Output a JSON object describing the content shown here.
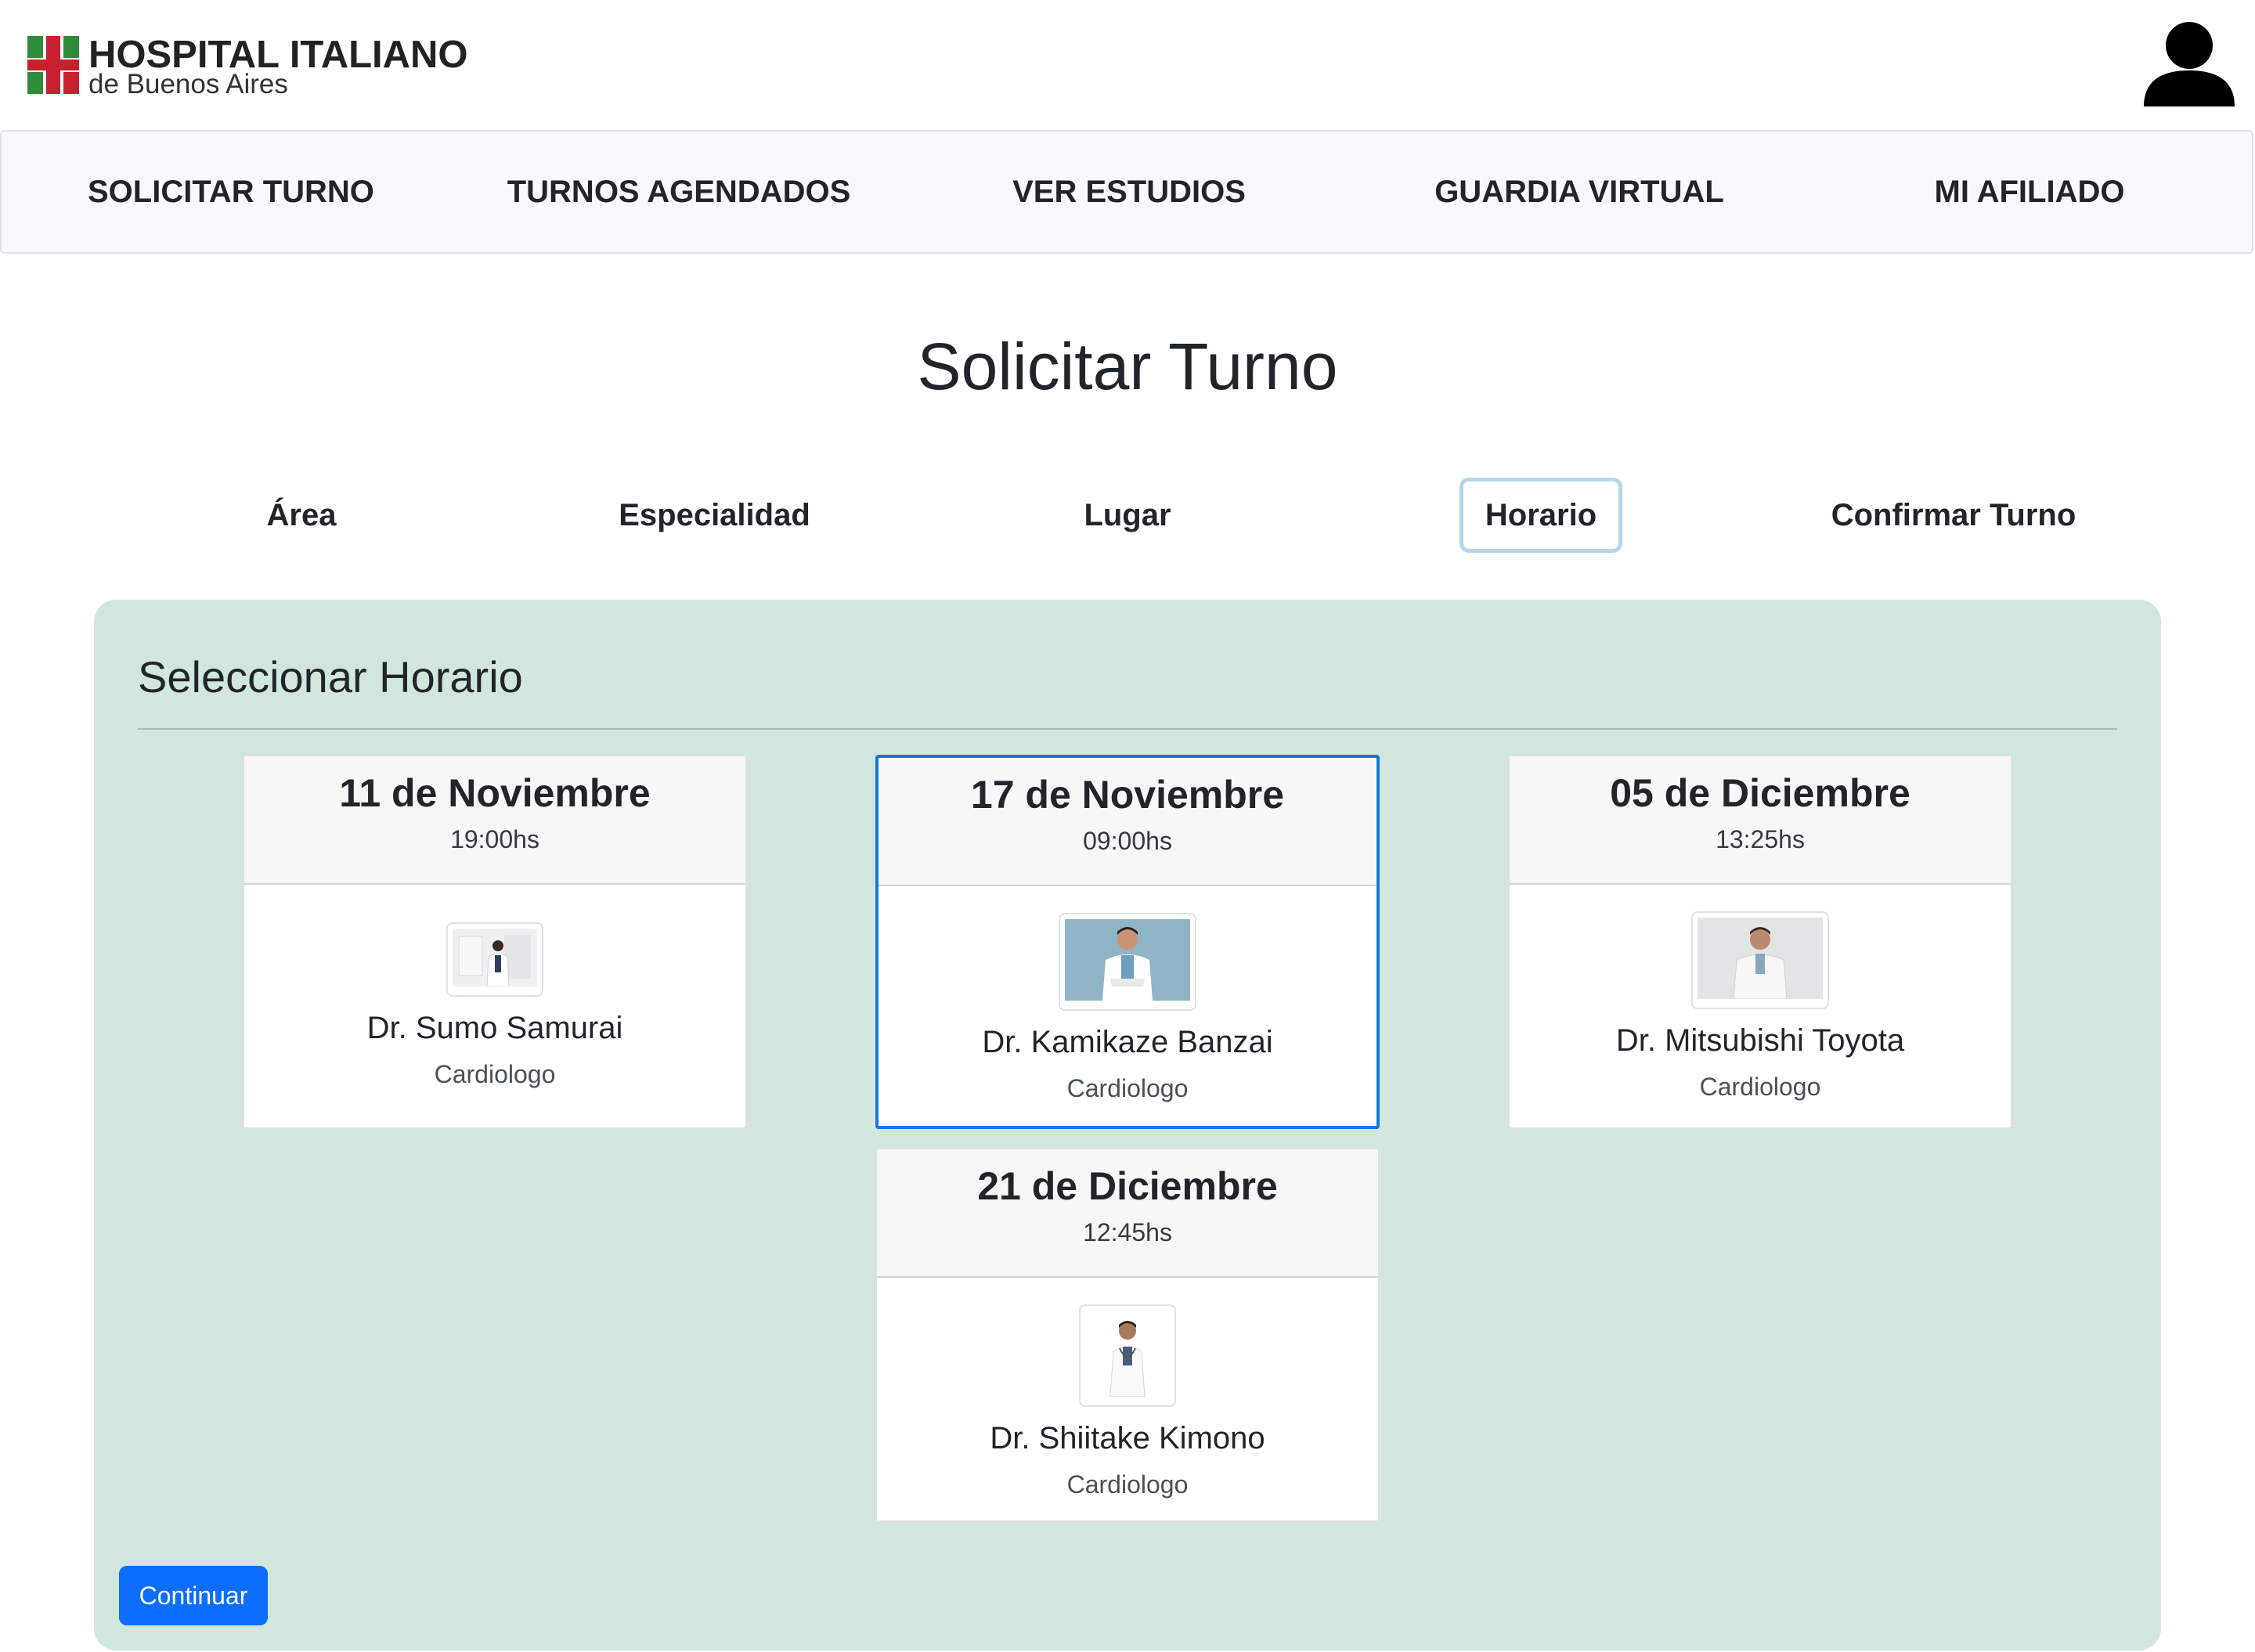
{
  "brand": {
    "name": "HOSPITAL ITALIANO",
    "subtitle": "de Buenos Aires",
    "colors": {
      "green": "#2e8b3a",
      "red": "#c8202f"
    }
  },
  "header": {
    "avatar_icon": "user-icon"
  },
  "nav": {
    "items": [
      {
        "label": "SOLICITAR TURNO"
      },
      {
        "label": "TURNOS AGENDADOS"
      },
      {
        "label": "VER ESTUDIOS"
      },
      {
        "label": "GUARDIA VIRTUAL"
      },
      {
        "label": "MI AFILIADO"
      }
    ]
  },
  "page": {
    "title": "Solicitar Turno"
  },
  "steps": {
    "items": [
      {
        "label": "Área"
      },
      {
        "label": "Especialidad"
      },
      {
        "label": "Lugar"
      },
      {
        "label": "Horario",
        "active": true
      },
      {
        "label": "Confirmar Turno"
      }
    ]
  },
  "panel": {
    "title": "Seleccionar Horario",
    "background": "#d1e7dd",
    "continue_label": "Continuar",
    "slots": [
      {
        "date": "11 de Noviembre",
        "time": "19:00hs",
        "doctor": "Dr. Sumo Samurai",
        "specialty": "Cardiologo",
        "selected": false
      },
      {
        "date": "17 de Noviembre",
        "time": "09:00hs",
        "doctor": "Dr. Kamikaze Banzai",
        "specialty": "Cardiologo",
        "selected": true
      },
      {
        "date": "05 de Diciembre",
        "time": "13:25hs",
        "doctor": "Dr. Mitsubishi Toyota",
        "specialty": "Cardiologo",
        "selected": false
      },
      {
        "date": "21 de Diciembre",
        "time": "12:45hs",
        "doctor": "Dr. Shiitake Kimono",
        "specialty": "Cardiologo",
        "selected": false
      }
    ]
  },
  "accent_color": "#0d6efd"
}
